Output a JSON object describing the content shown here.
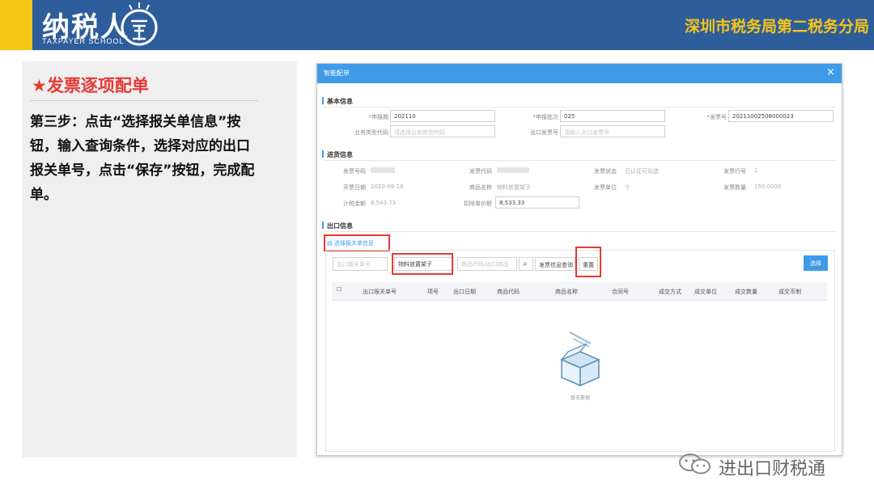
{
  "header": {
    "logo_text": "纳税人",
    "logo_subtitle": "TAXPAYER SCHOOL",
    "organization": "深圳市税务局第二税务分局"
  },
  "panel": {
    "title": "★发票逐项配单",
    "step_text": "第三步：点击“选择报关单信息”按钮，输入查询条件，选择对应的出口报关单号，点击“保存”按钮，完成配单。"
  },
  "dialog": {
    "title": "智能配单",
    "close_glyph": "×",
    "sections": {
      "basic": "基本信息",
      "purchase": "进货信息",
      "export": "出口信息"
    },
    "basic_fields": {
      "declare_period_label": "*申报期",
      "declare_period_value": "202110",
      "declare_batch_label": "*申报批次",
      "declare_batch_value": "025",
      "invoice_no_label": "*发票号",
      "invoice_no_value": "20211002508000023",
      "customs_code_label": "业务类型代码",
      "customs_code_placeholder": "请选择业务类型代码",
      "export_invoice_label": "出口发票号",
      "export_invoice_placeholder": "请输入出口发票号"
    },
    "purchase_fields": {
      "invoice_no_label": "发票号码",
      "invoice_code_label": "发票代码",
      "invoice_status_label": "发票状态",
      "invoice_status_value": "已认证可勾选",
      "invoice_row_label": "发票行号",
      "invoice_row_value": "1",
      "issue_date_label": "开票日期",
      "issue_date_value": "2020-09-18",
      "goods_name_label": "商品名称",
      "goods_name_value": "物料放置架子",
      "invoice_unit_label": "发票单位",
      "invoice_unit_value": "个",
      "invoice_qty_label": "发票数量",
      "invoice_qty_value": "150.0000",
      "tax_amount_label": "计税金额",
      "tax_amount_value": "8,543.73",
      "deductible_label": "扣除单价额",
      "deductible_value": "8,533.33"
    },
    "export_section": {
      "select_customs_link": "选择报关单信息",
      "filter_customs_no_placeholder": "出口报关单号",
      "filter_goods_value": "物料放置架子",
      "filter_goods_code_placeholder": "商品代码/出口商品",
      "search_glyph": "⌕",
      "show_all_button": "发票信息查询",
      "reset_button": "重置",
      "select_button": "选择",
      "columns": [
        "出口报关单号",
        "项号",
        "出口日期",
        "商品代码",
        "商品名称",
        "合同号",
        "成交方式",
        "成交单位",
        "成交数量",
        "成交币制"
      ],
      "empty_text": "暂无数据"
    }
  },
  "watermark": {
    "text": "进出口财税通"
  },
  "colors": {
    "header_blue": "#2e5d9c",
    "accent_yellow": "#f5c518",
    "title_red": "#e53935",
    "dialog_blue": "#3d9be9"
  }
}
